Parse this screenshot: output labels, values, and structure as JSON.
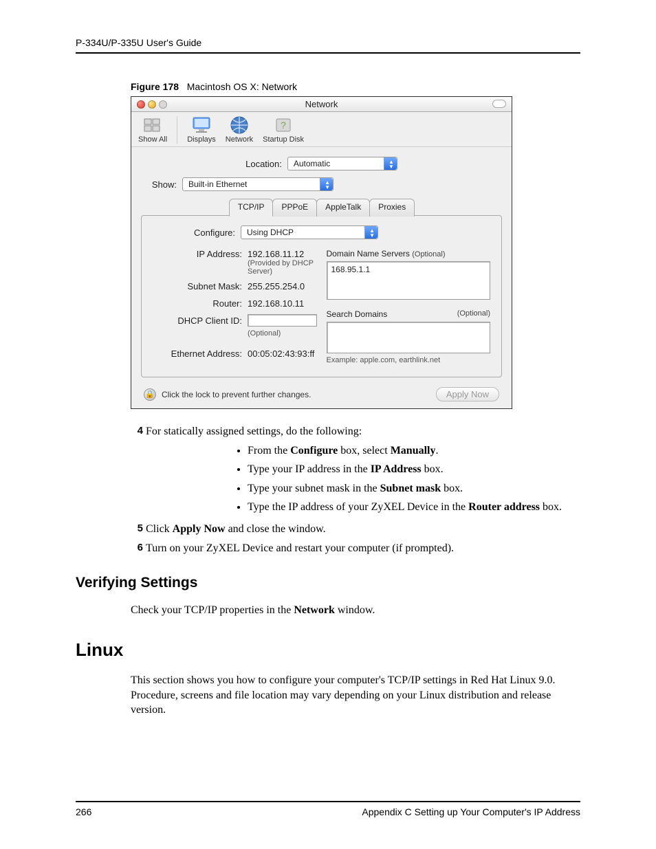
{
  "header": "P-334U/P-335U User's Guide",
  "figure": {
    "label": "Figure 178",
    "caption": "Macintosh OS X: Network"
  },
  "window": {
    "title": "Network",
    "toolbar": {
      "showall": "Show All",
      "displays": "Displays",
      "network": "Network",
      "startup": "Startup Disk"
    },
    "location": {
      "label": "Location:",
      "value": "Automatic"
    },
    "show": {
      "label": "Show:",
      "value": "Built-in Ethernet"
    },
    "tabs": {
      "tcpip": "TCP/IP",
      "pppoe": "PPPoE",
      "appletalk": "AppleTalk",
      "proxies": "Proxies"
    },
    "configure": {
      "label": "Configure:",
      "value": "Using DHCP"
    },
    "left": {
      "ip_label": "IP Address:",
      "ip_value": "192.168.11.12",
      "ip_sub": "(Provided by DHCP Server)",
      "subnet_label": "Subnet Mask:",
      "subnet_value": "255.255.254.0",
      "router_label": "Router:",
      "router_value": "192.168.10.11",
      "dhcp_label": "DHCP Client ID:",
      "dhcp_sub": "(Optional)",
      "eth_label": "Ethernet Address:",
      "eth_value": "00:05:02:43:93:ff"
    },
    "right": {
      "dns_label": "Domain Name Servers",
      "optional": "(Optional)",
      "dns_value": "168.95.1.1",
      "search_label": "Search Domains",
      "example": "Example: apple.com, earthlink.net"
    },
    "lock_text": "Click the lock to prevent further changes.",
    "apply": "Apply Now"
  },
  "steps": {
    "s4": "For statically assigned settings, do the following:",
    "b1a": "From the ",
    "b1b": "Configure",
    "b1c": " box, select ",
    "b1d": "Manually",
    "b1e": ".",
    "b2a": "Type your IP address in the ",
    "b2b": "IP Address",
    "b2c": " box.",
    "b3a": "Type your subnet mask in the ",
    "b3b": "Subnet mask",
    "b3c": " box.",
    "b4a": "Type the IP address of your ZyXEL Device in the ",
    "b4b": "Router address",
    "b4c": " box.",
    "s5a": "Click ",
    "s5b": "Apply Now",
    "s5c": " and close the window.",
    "s6": "Turn on your ZyXEL Device and restart your computer (if prompted)."
  },
  "verifying": {
    "heading": "Verifying Settings",
    "text_a": "Check your TCP/IP properties in the ",
    "text_b": "Network",
    "text_c": " window."
  },
  "linux": {
    "heading": "Linux",
    "para": "This section shows you how to configure your computer's TCP/IP settings in Red Hat Linux 9.0. Procedure, screens and file location may vary depending on your Linux distribution and release version."
  },
  "footer": {
    "page": "266",
    "right": "Appendix C Setting up Your Computer's IP Address"
  }
}
